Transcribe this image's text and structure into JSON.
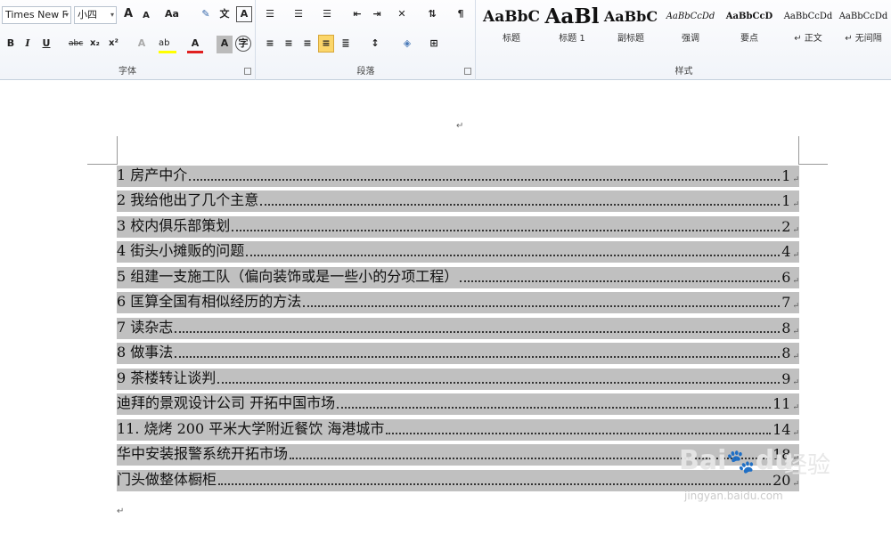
{
  "ribbon": {
    "font_group": {
      "label": "字体",
      "font_name": "Times New F",
      "font_size": "小四",
      "grow_font": "A",
      "shrink_font": "A",
      "change_case": "Aa",
      "bold": "B",
      "italic": "I",
      "underline": "U",
      "strikethrough": "abc",
      "subscript": "x₂",
      "superscript": "x²",
      "font_color_letter": "A"
    },
    "paragraph_group": {
      "label": "段落"
    },
    "styles_group": {
      "label": "样式",
      "items": [
        {
          "sample": "AaBbC",
          "name": "标题"
        },
        {
          "sample": "AaBl",
          "name": "标题 1"
        },
        {
          "sample": "AaBbC",
          "name": "副标题"
        },
        {
          "sample": "AaBbCcDd",
          "name": "强调"
        },
        {
          "sample": "AaBbCcD",
          "name": "要点"
        },
        {
          "sample": "AaBbCcDd",
          "name": "↵ 正文"
        },
        {
          "sample": "AaBbCcDd",
          "name": "↵ 无间隔"
        }
      ]
    }
  },
  "document": {
    "toc": [
      {
        "title": "1 房产中介",
        "page": "1"
      },
      {
        "title": "2 我给他出了几个主意",
        "page": "1"
      },
      {
        "title": "3 校内俱乐部策划",
        "page": "2"
      },
      {
        "title": "4 街头小摊贩的问题",
        "page": "4"
      },
      {
        "title": "5 组建一支施工队（偏向装饰或是一些小的分项工程）",
        "page": "6"
      },
      {
        "title": "6 匡算全国有相似经历的方法",
        "page": "7"
      },
      {
        "title": "7 读杂志",
        "page": "8"
      },
      {
        "title": "8 做事法",
        "page": "8"
      },
      {
        "title": "9 茶楼转让谈判",
        "page": "9"
      },
      {
        "title": "迪拜的景观设计公司 开拓中国市场",
        "page": "11"
      },
      {
        "title": "11.   烧烤 200 平米大学附近餐饮 海港城市",
        "page": "14"
      },
      {
        "title": "华中安装报警系统开拓市场",
        "page": "18"
      },
      {
        "title": "门头做整体橱柜",
        "page": "20"
      }
    ],
    "paragraph_mark": "↵"
  },
  "watermark": {
    "logo": "Bai du",
    "text": "经验",
    "url": "jingyan.baidu.com"
  }
}
